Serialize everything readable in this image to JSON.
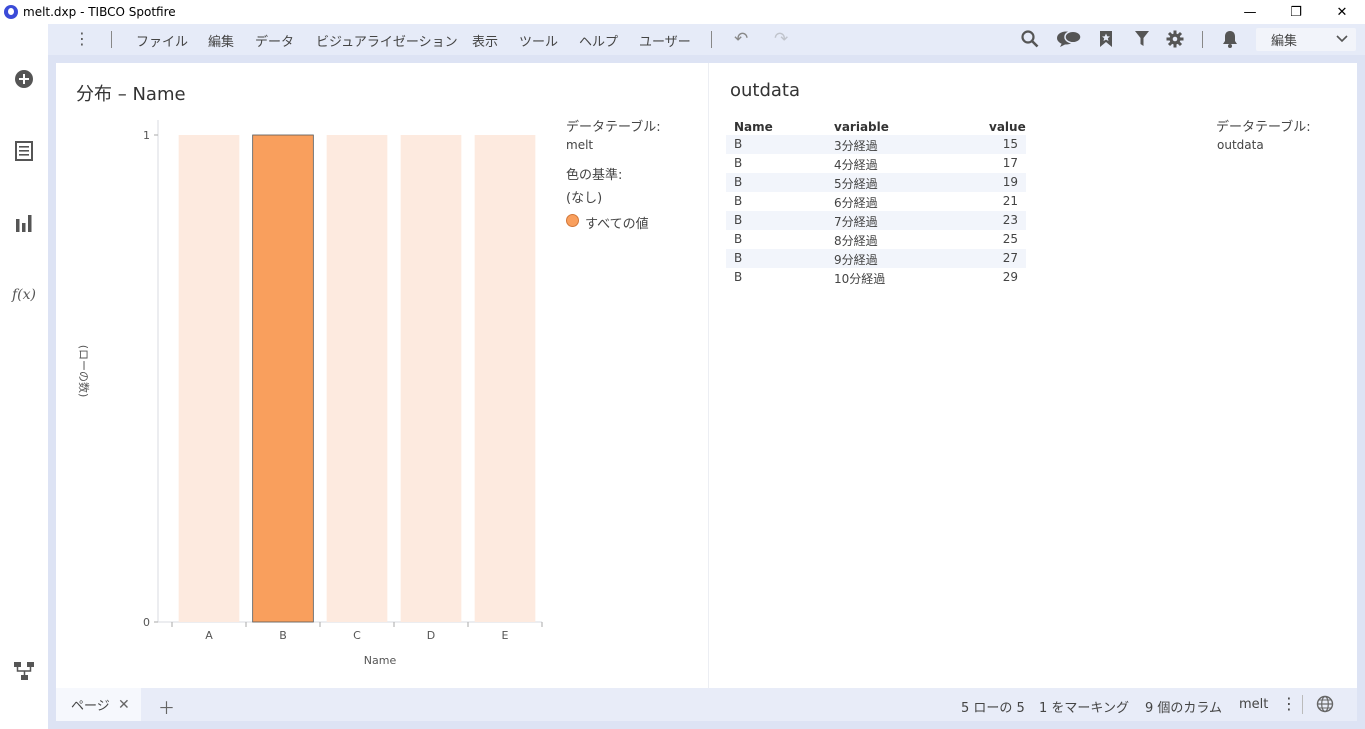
{
  "window": {
    "title": "melt.dxp - TIBCO Spotfire",
    "controls": {
      "minimize": "—",
      "restore": "❐",
      "close": "✕"
    }
  },
  "menu": {
    "items": [
      "ファイル",
      "編集",
      "データ",
      "ビジュアライゼーション",
      "表示",
      "ツール",
      "ヘルプ",
      "ユーザー"
    ],
    "mode_label": "編集"
  },
  "left_rail": {
    "icons": [
      "add-circle-icon",
      "data-table-icon",
      "bar-chart-icon",
      "function-icon",
      "data-canvas-icon"
    ],
    "fx_label": "f(x)"
  },
  "toolbar_icons": [
    "search-icon",
    "comments-icon",
    "bookmark-icon",
    "filter-icon",
    "settings-icon",
    "notification-icon"
  ],
  "bar_viz": {
    "title": "分布 – Name",
    "legend": {
      "table_label": "データテーブル:",
      "table_value": "melt",
      "color_label": "色の基準:",
      "color_value": "(なし)",
      "item_label": "すべての値"
    }
  },
  "chart_data": {
    "type": "bar",
    "categories": [
      "A",
      "B",
      "C",
      "D",
      "E"
    ],
    "values": [
      1,
      1,
      1,
      1,
      1
    ],
    "marked": [
      false,
      true,
      false,
      false,
      false
    ],
    "xlabel": "Name",
    "ylabel": "(ローの数)",
    "ylim": [
      0,
      1
    ],
    "y_ticks": [
      "0",
      "1"
    ],
    "colors": {
      "marked": "#f99f5d",
      "unmarked": "#fdeadf",
      "marked_stroke": "#555555"
    }
  },
  "table_viz": {
    "title": "outdata",
    "legend": {
      "table_label": "データテーブル:",
      "table_value": "outdata"
    },
    "columns": [
      "Name",
      "variable",
      "value"
    ],
    "rows": [
      [
        "B",
        "3分経過",
        "15"
      ],
      [
        "B",
        "4分経過",
        "17"
      ],
      [
        "B",
        "5分経過",
        "19"
      ],
      [
        "B",
        "6分経過",
        "21"
      ],
      [
        "B",
        "7分経過",
        "23"
      ],
      [
        "B",
        "8分経過",
        "25"
      ],
      [
        "B",
        "9分経過",
        "27"
      ],
      [
        "B",
        "10分経過",
        "29"
      ]
    ]
  },
  "status": {
    "page_tab": "ページ",
    "rows": "5 ローの 5",
    "marked": "1 をマーキング",
    "columns": "9 個のカラム",
    "table": "melt"
  }
}
